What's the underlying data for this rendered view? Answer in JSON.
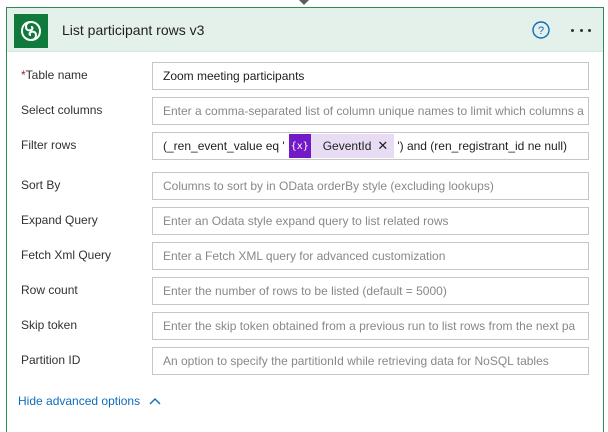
{
  "action": {
    "title": "List participant rows v3"
  },
  "fields": [
    {
      "label": "Table name",
      "required": true,
      "value": "Zoom meeting participants",
      "kind": "dropdown"
    },
    {
      "label": "Select columns",
      "placeholder": "Enter a comma-separated list of column unique names to limit which columns a"
    },
    {
      "label": "Filter rows",
      "value_before": "(_ren_event_value eq '",
      "token_label": "GeventId",
      "token_icon": "{x}",
      "value_after": "') and (ren_registrant_id ne null)"
    },
    {
      "label": "Sort By",
      "placeholder": "Columns to sort by in OData orderBy style (excluding lookups)"
    },
    {
      "label": "Expand Query",
      "placeholder": "Enter an Odata style expand query to list related rows"
    },
    {
      "label": "Fetch Xml Query",
      "placeholder": "Enter a Fetch XML query for advanced customization"
    },
    {
      "label": "Row count",
      "placeholder": "Enter the number of rows to be listed (default = 5000)"
    },
    {
      "label": "Skip token",
      "placeholder": "Enter the skip token obtained from a previous run to list rows from the next pa"
    },
    {
      "label": "Partition ID",
      "placeholder": "An option to specify the partitionId while retrieving data for NoSQL tables"
    }
  ],
  "footer": {
    "toggle_label": "Hide advanced options"
  },
  "colors": {
    "accent_green": "#0f7a3c",
    "header_bg": "#e4f1ea",
    "link_blue": "#0f6cbd",
    "token_purple": "#7219c8",
    "token_bg": "#e8dcf5"
  },
  "icons": {
    "logo": "dataverse-logo-icon",
    "help": "help-circle-icon",
    "more": "more-options-icon",
    "dropdown": "chevron-down-icon",
    "collapse": "chevron-up-icon"
  }
}
